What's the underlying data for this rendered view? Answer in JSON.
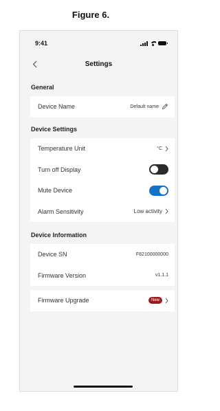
{
  "caption": "Figure 6.",
  "status_bar": {
    "time": "9:41"
  },
  "nav": {
    "title": "Settings"
  },
  "general": {
    "header": "General",
    "device_name": {
      "label": "Device Name",
      "value": "Default name"
    }
  },
  "device_settings": {
    "header": "Device Settings",
    "temperature_unit": {
      "label": "Temperature Unit",
      "value": "°C"
    },
    "turn_off_display": {
      "label": "Turn off Display",
      "on": false
    },
    "mute_device": {
      "label": "Mute Device",
      "on": true
    },
    "alarm_sensitivity": {
      "label": "Alarm Sensitivity",
      "value": "Low activity"
    }
  },
  "device_information": {
    "header": "Device Information",
    "device_sn": {
      "label": "Device SN",
      "value": "F82100000000"
    },
    "firmware_version": {
      "label": "Firmware Version",
      "value": "v1.1.1"
    }
  },
  "firmware_upgrade": {
    "label": "Firmware Upgrade",
    "badge": "New"
  },
  "colors": {
    "accent": "#1572c5",
    "badge": "#9b1c20",
    "background": "#f4f4f4"
  },
  "icons": [
    "back-chevron-icon",
    "pencil-icon",
    "chevron-right-icon",
    "signal-icon",
    "wifi-icon",
    "battery-icon"
  ]
}
